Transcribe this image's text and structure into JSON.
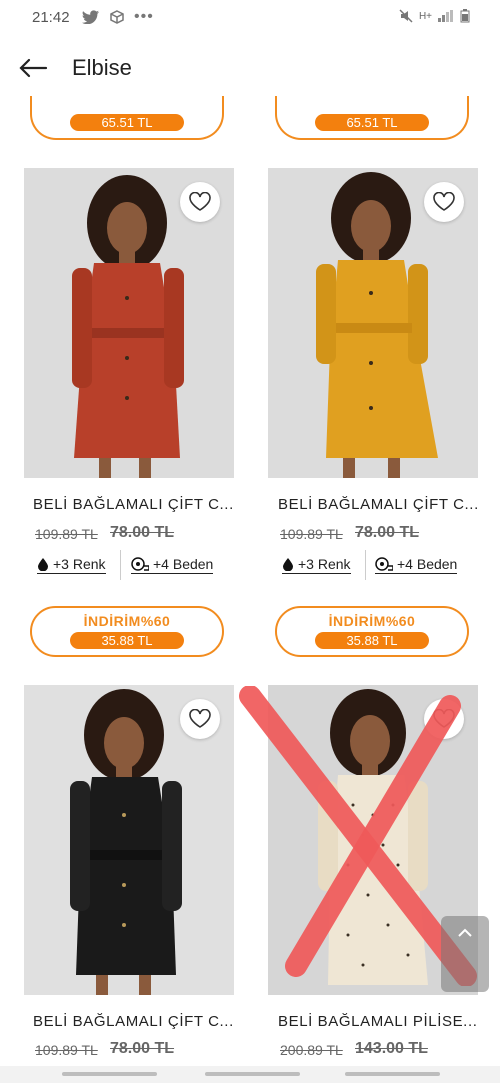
{
  "status_bar": {
    "time": "21:42",
    "network": "H+"
  },
  "header": {
    "title": "Elbise"
  },
  "top_cards": [
    {
      "price": "65.51 TL"
    },
    {
      "price": "65.51 TL"
    }
  ],
  "products": [
    {
      "name": "BELİ BAĞLAMALI ÇİFT C...",
      "old_price": "109.89 TL",
      "strike_price": "78.00 TL",
      "colors": "+3 Renk",
      "sizes": "+4 Beden",
      "discount_label": "İNDİRİM%60",
      "discount_price": "35.88 TL",
      "dress_color": "#b8402a"
    },
    {
      "name": "BELİ BAĞLAMALI ÇİFT C...",
      "old_price": "109.89 TL",
      "strike_price": "78.00 TL",
      "colors": "+3 Renk",
      "sizes": "+4 Beden",
      "discount_label": "İNDİRİM%60",
      "discount_price": "35.88 TL",
      "dress_color": "#e0a020"
    },
    {
      "name": "BELİ BAĞLAMALI ÇİFT C...",
      "old_price": "109.89 TL",
      "strike_price": "78.00 TL",
      "dress_color": "#1a1a1a"
    },
    {
      "name": "BELİ BAĞLAMALI PİLİSE...",
      "old_price": "200.89 TL",
      "strike_price": "143.00 TL",
      "dress_color": "#efe6d4"
    }
  ],
  "colors": {
    "accent": "#f28c1f",
    "price_fill": "#f3800e",
    "cross_mark": "#f05a5a"
  }
}
